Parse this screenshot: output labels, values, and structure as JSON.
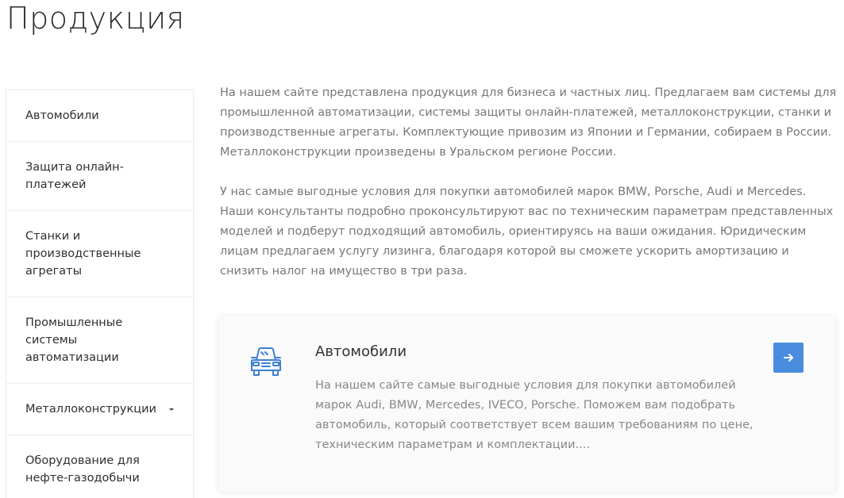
{
  "page": {
    "title": "Продукция"
  },
  "sidebar": {
    "items": [
      {
        "label": "Автомобили",
        "has_submenu": false
      },
      {
        "label": "Защита онлайн-платежей",
        "has_submenu": false
      },
      {
        "label": "Станки и производственные агрегаты",
        "has_submenu": false
      },
      {
        "label": "Промышленные системы автоматизации",
        "has_submenu": false
      },
      {
        "label": "Металлоконструкции",
        "has_submenu": true,
        "icon": "caret-down-icon"
      },
      {
        "label": "Оборудование для нефте-газодобычи",
        "has_submenu": false
      }
    ]
  },
  "content": {
    "intro_paragraph": "На нашем сайте представлена продукция для бизнеса и частных лиц. Предлагаем вам системы для промышленной автоматизации, системы защиты онлайн-платежей, металлоконструкции, станки и производственные агрегаты. Комплектующие привозим из Японии и Германии, собираем в России. Металлоконструкции произведены в Уральском регионе России.",
    "second_paragraph": "У нас самые выгодные условия для покупки автомобилей марок BMW, Porsche, Audi и Mercedes. Наши консультанты подробно проконсультируют вас по техническим параметрам представленных моделей и подберут подходящий автомобиль, ориентируясь на ваши ожидания. Юридическим лицам предлагаем услугу лизинга, благодаря которой вы сможете ускорить амортизацию и снизить налог на имущество в три раза."
  },
  "card": {
    "icon": "car-icon",
    "title": "Автомобили",
    "text": "На нашем сайте самые выгодные условия для покупки автомобилей марок Audi, BMW, Mercedes, IVECO, Porsche. Поможем вам подобрать автомобиль, который соответствует всем вашим требованиям по цене, техническим параметрам и комплектации....",
    "arrow_icon": "arrow-right-icon"
  },
  "colors": {
    "accent": "#4a8cde",
    "text_main": "#2f2f2f",
    "text_muted": "#777777",
    "border": "#ececec"
  }
}
